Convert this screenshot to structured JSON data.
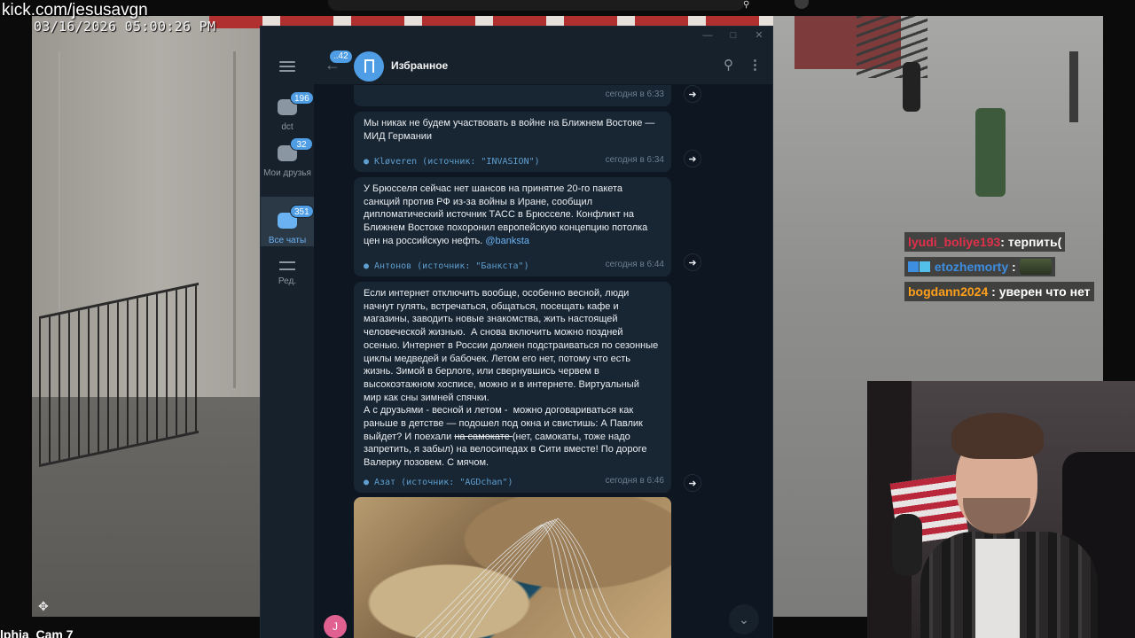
{
  "stream": {
    "channel_url": "kick.com/jesusavgn",
    "cam_timestamp": "03/16/2026 05:00:26 PM",
    "cam_label": "lphia_Cam 7"
  },
  "telegram": {
    "folders": [
      {
        "label": "dct",
        "badge": "196"
      },
      {
        "label": "Мои друзья",
        "badge": "32"
      },
      {
        "label": "Все чаты",
        "badge": "351"
      },
      {
        "label": "Ред.",
        "badge": ""
      }
    ],
    "header": {
      "back_badge": "..42",
      "title": "Избранное"
    },
    "messages": [
      {
        "time": "сегодня в 6:33"
      },
      {
        "text": "Мы никак не будем участвовать в войне на Ближнем Востоке —\nМИД Германии",
        "signature": "Kløveren (источник: \"INVASION\")",
        "time": "сегодня в 6:34"
      },
      {
        "text_before_link": "У Брюсселя сейчас нет шансов на принятие 20-го пакета\nсанкций против РФ из-за войны в Иране, сообщил\nдипломатический источник ТАСС в Брюсселе. Конфликт на\nБлижнем Востоке похоронил европейскую концепцию потолка\nцен на российскую нефть. ",
        "link": "@banksta",
        "signature": "Антонов (источник: \"Банкста\")",
        "time": "сегодня в 6:44"
      },
      {
        "text_part1": "Если интернет отключить вообще, особенно весной, люди\nначнут гулять, встречаться, общаться, посещать кафе и\nмагазины, заводить новые знакомства, жить настоящей\nчеловеческой жизнью.  А снова включить можно поздней\nосенью. Интернет в России должен подстраиваться по сезонные\nциклы медведей и бабочек. Летом его нет, потому что есть\nжизнь. Зимой в берлоге, или свернувшись червем в\nвысокоэтажном хосписе, можно и в интернете. Виртуальный\nмир как сны зимней спячки.\nА с друзьями - весной и летом -  можно договариваться как\nраньше в детстве — подошел под окна и свистишь: А Павлик\nвыйдет? И поехали ",
        "strike": "на самокате ",
        "text_part2": "(нет, самокаты, тоже надо\nзапретить, я забыл) на велосипедах в Сити вместе! По дороге\nВалерку позовем. С мячом.",
        "signature": "Азат (источник: \"AGDchan\")",
        "time": "сегодня в 6:46"
      }
    ],
    "composer_avatar_letter": "J"
  },
  "stream_chat": [
    {
      "user": "lyudi_boliye193",
      "message": "терпить("
    },
    {
      "user": "etozhemorty",
      "message": ""
    },
    {
      "user": "bogdann2024",
      "message": "уверен что нет"
    }
  ],
  "colors": {
    "telegram_bg": "#0e1621",
    "telegram_panel": "#17212b",
    "bubble": "#182533",
    "accent": "#4f9de4",
    "link": "#6ab2f2"
  },
  "icons": [
    "menu-icon",
    "bookmark-icon",
    "search-icon",
    "more-vertical-icon",
    "forward-icon",
    "chevron-down-icon",
    "back-arrow-icon",
    "edit-folders-icon",
    "move-icon"
  ]
}
